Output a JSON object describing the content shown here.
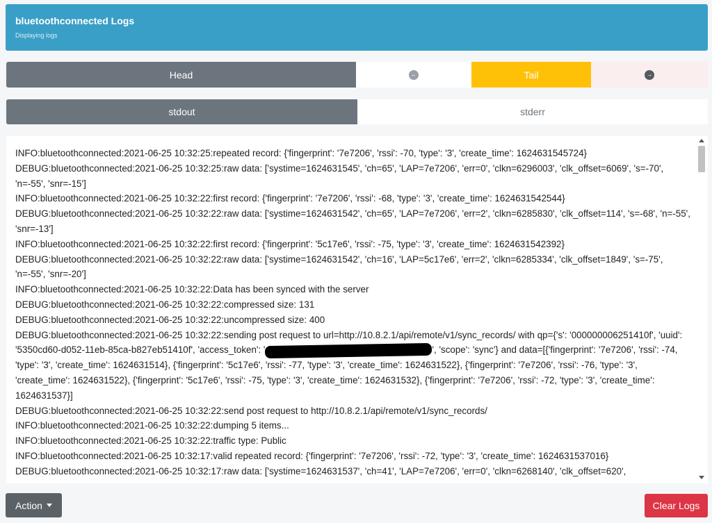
{
  "header": {
    "title": "bluetoothconnected Logs",
    "subtitle": "Displaying logs"
  },
  "nav": {
    "head_label": "Head",
    "tail_label": "Tail",
    "prev_icon": "arrow-left-circle-icon",
    "next_icon": "arrow-right-circle-icon"
  },
  "streams": {
    "stdout_label": "stdout",
    "stderr_label": "stderr"
  },
  "logs": [
    "INFO:bluetoothconnected:2021-06-25 10:32:25:repeated record: {'fingerprint': '7e7206', 'rssi': -70, 'type': '3', 'create_time': 1624631545724}",
    "DEBUG:bluetoothconnected:2021-06-25 10:32:25:raw data: ['systime=1624631545', 'ch=65', 'LAP=7e7206', 'err=0', 'clkn=6296003', 'clk_offset=6069', 's=-70', 'n=-55', 'snr=-15']",
    "INFO:bluetoothconnected:2021-06-25 10:32:22:first record: {'fingerprint': '7e7206', 'rssi': -68, 'type': '3', 'create_time': 1624631542544}",
    "DEBUG:bluetoothconnected:2021-06-25 10:32:22:raw data: ['systime=1624631542', 'ch=65', 'LAP=7e7206', 'err=2', 'clkn=6285830', 'clk_offset=114', 's=-68', 'n=-55', 'snr=-13']",
    "INFO:bluetoothconnected:2021-06-25 10:32:22:first record: {'fingerprint': '5c17e6', 'rssi': -75, 'type': '3', 'create_time': 1624631542392}",
    "DEBUG:bluetoothconnected:2021-06-25 10:32:22:raw data: ['systime=1624631542', 'ch=16', 'LAP=5c17e6', 'err=2', 'clkn=6285334', 'clk_offset=1849', 's=-75', 'n=-55', 'snr=-20']",
    "INFO:bluetoothconnected:2021-06-25 10:32:22:Data has been synced with the server",
    "DEBUG:bluetoothconnected:2021-06-25 10:32:22:compressed size: 131",
    "DEBUG:bluetoothconnected:2021-06-25 10:32:22:uncompressed size: 400"
  ],
  "log_post": {
    "part1": "DEBUG:bluetoothconnected:2021-06-25 10:32:22:sending post request to url=http://10.8.2.1/api/remote/v1/sync_records/ with qp={'s': '000000006251410f', 'uuid': '5350cd60-d052-11eb-85ca-b827eb51410f', 'access_token': '",
    "part2": "', 'scope': 'sync'} and data=[{'fingerprint': '7e7206', 'rssi': -74, 'type': '3', 'create_time': 1624631514}, {'fingerprint': '5c17e6', 'rssi': -77, 'type': '3', 'create_time': 1624631522}, {'fingerprint': '7e7206', 'rssi': -76, 'type': '3', 'create_time': 1624631522}, {'fingerprint': '5c17e6', 'rssi': -75, 'type': '3', 'create_time': 1624631532}, {'fingerprint': '7e7206', 'rssi': -72, 'type': '3', 'create_time': 1624631537}]"
  },
  "logs_tail": [
    "DEBUG:bluetoothconnected:2021-06-25 10:32:22:send post request to http://10.8.2.1/api/remote/v1/sync_records/",
    "INFO:bluetoothconnected:2021-06-25 10:32:22:dumping 5 items...",
    "INFO:bluetoothconnected:2021-06-25 10:32:22:traffic type: Public",
    "INFO:bluetoothconnected:2021-06-25 10:32:17:valid repeated record: {'fingerprint': '7e7206', 'rssi': -72, 'type': '3', 'create_time': 1624631537016}",
    "DEBUG:bluetoothconnected:2021-06-25 10:32:17:raw data: ['systime=1624631537', 'ch=41', 'LAP=7e7206', 'err=0', 'clkn=6268140', 'clk_offset=620',"
  ],
  "footer": {
    "action_label": "Action",
    "clear_label": "Clear Logs"
  },
  "colors": {
    "header_bg": "#3a9fc7",
    "secondary": "#6c757d",
    "warning": "#ffc107",
    "danger": "#dc3545"
  }
}
